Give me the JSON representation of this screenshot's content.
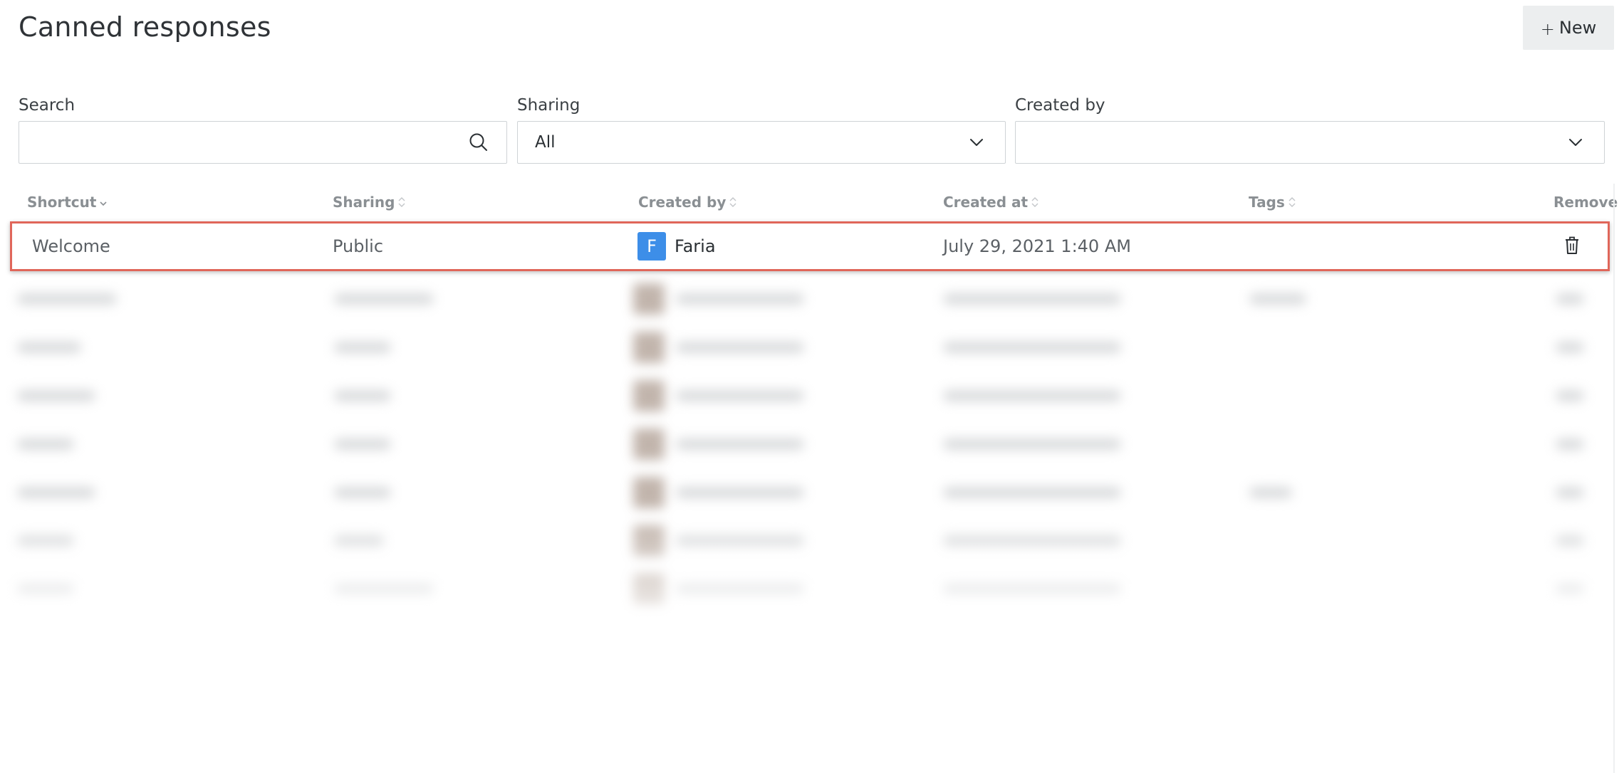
{
  "header": {
    "title": "Canned responses",
    "new_button_label": "New"
  },
  "filters": {
    "search_label": "Search",
    "search_value": "",
    "sharing_label": "Sharing",
    "sharing_selected": "All",
    "created_by_label": "Created by",
    "created_by_selected": ""
  },
  "table": {
    "columns": [
      "Shortcut",
      "Sharing",
      "Created by",
      "Created at",
      "Tags",
      "Remove"
    ],
    "rows": [
      {
        "shortcut": "Welcome",
        "sharing": "Public",
        "creator_initial": "F",
        "creator_name": "Faria",
        "created_at": "July 29, 2021 1:40 AM",
        "tags": ""
      }
    ]
  },
  "icons": {
    "new": "plus-icon",
    "search": "search-icon",
    "dropdown": "chevron-down-icon",
    "sort": "sort-icon",
    "remove": "trash-icon"
  },
  "colors": {
    "avatar_bg": "#3d8ee8",
    "highlight_border": "#e0665a",
    "button_bg": "#eceeef"
  }
}
